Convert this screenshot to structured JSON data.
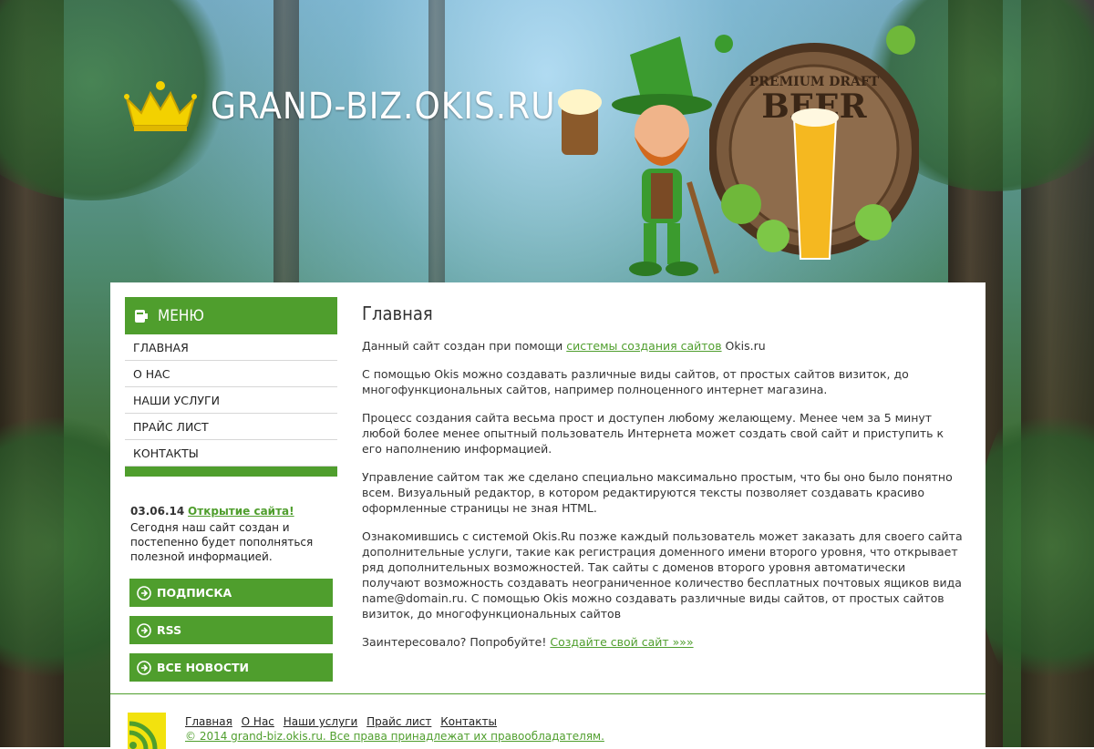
{
  "site": {
    "logo_text": "GRAND-BIZ.OKIS.RU",
    "barrel_text_top": "PREMIUM DRAFT",
    "barrel_text_main": "BEER"
  },
  "sidebar": {
    "menu_title": "МЕНЮ",
    "items": [
      {
        "label": "ГЛАВНАЯ"
      },
      {
        "label": "О НАС"
      },
      {
        "label": "НАШИ УСЛУГИ"
      },
      {
        "label": "ПРАЙС ЛИСТ"
      },
      {
        "label": "КОНТАКТЫ"
      }
    ],
    "news": {
      "date": "03.06.14",
      "title": "Открытие сайта!",
      "text": "Сегодня наш сайт создан и постепенно будет пополняться полезной информацией."
    },
    "buttons": [
      {
        "label": "ПОДПИСКА"
      },
      {
        "label": "RSS"
      },
      {
        "label": "ВСЕ НОВОСТИ"
      }
    ]
  },
  "content": {
    "title": "Главная",
    "p1_before": "Данный сайт создан при помощи ",
    "p1_link": "системы создания сайтов",
    "p1_after": " Okis.ru",
    "p2": "С помощью Okis можно создавать различные виды сайтов, от простых сайтов визиток, до многофункциональных сайтов, например полноценного интернет магазина.",
    "p3": "Процесс создания сайта весьма прост и доступен любому желающему. Менее чем за 5 минут любой более менее опытный пользователь Интернета может создать свой сайт и приступить к его наполнению информацией.",
    "p4": "Управление сайтом так же сделано специально максимально простым, что бы оно было понятно всем. Визуальный редактор, в котором редактируются тексты позволяет создавать красиво оформленные страницы не зная HTML.",
    "p5": "Ознакомившись с системой Okis.Ru позже каждый пользователь может заказать для своего сайта дополнительные услуги, такие как регистрация доменного имени второго уровня, что открывает ряд дополнительных возможностей. Так сайты с доменов второго уровня автоматически получают возможность создавать неограниченное количество бесплатных почтовых ящиков вида name@domain.ru. С помощью Okis можно создавать различные виды сайтов, от простых сайтов визиток, до многофункциональных сайтов",
    "p6_before": "Заинтересовало? Попробуйте! ",
    "p6_link": "Создайте свой сайт »»»"
  },
  "footer": {
    "links": [
      {
        "label": "Главная"
      },
      {
        "label": "О Нас"
      },
      {
        "label": "Наши услуги"
      },
      {
        "label": "Прайс лист"
      },
      {
        "label": "Контакты"
      }
    ],
    "copyright": "© 2014 grand-biz.okis.ru. Все права принадлежат их правообладателям."
  },
  "colors": {
    "accent": "#4f9e2d",
    "rss": "#f2e20e"
  }
}
